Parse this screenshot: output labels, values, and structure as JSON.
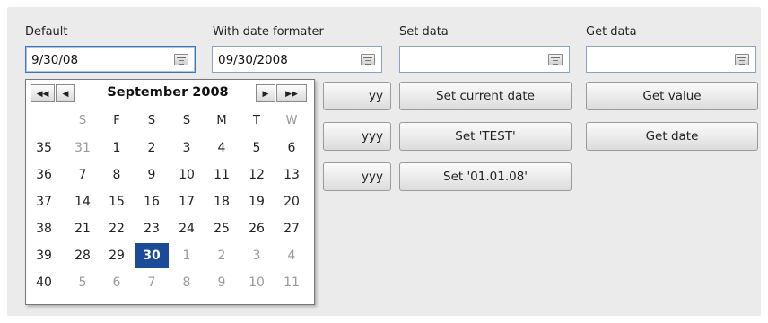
{
  "columns": [
    {
      "label": "Default",
      "value": "9/30/08"
    },
    {
      "label": "With date formater",
      "value": "09/30/2008"
    },
    {
      "label": "Set data",
      "value": ""
    },
    {
      "label": "Get data",
      "value": ""
    }
  ],
  "hidden_buttons": [
    "yy",
    "yyy",
    "yyy"
  ],
  "set_buttons": [
    "Set current date",
    "Set 'TEST'",
    "Set '01.01.08'"
  ],
  "get_buttons": [
    "Get value",
    "Get date"
  ],
  "calendar": {
    "title": "September 2008",
    "nav": {
      "prev_year": "◀◀",
      "prev_month": "◀",
      "next_month": "▶",
      "next_year": "▶▶"
    },
    "weekdays": [
      "S",
      "F",
      "S",
      "S",
      "M",
      "T",
      "W"
    ],
    "weeks": [
      {
        "num": "35",
        "days": [
          "31",
          "1",
          "2",
          "3",
          "4",
          "5",
          "6"
        ]
      },
      {
        "num": "36",
        "days": [
          "7",
          "8",
          "9",
          "10",
          "11",
          "12",
          "13"
        ]
      },
      {
        "num": "37",
        "days": [
          "14",
          "15",
          "16",
          "17",
          "18",
          "19",
          "20"
        ]
      },
      {
        "num": "38",
        "days": [
          "21",
          "22",
          "23",
          "24",
          "25",
          "26",
          "27"
        ]
      },
      {
        "num": "39",
        "days": [
          "28",
          "29",
          "30",
          "1",
          "2",
          "3",
          "4"
        ]
      },
      {
        "num": "40",
        "days": [
          "5",
          "6",
          "7",
          "8",
          "9",
          "10",
          "11"
        ]
      }
    ],
    "selected": "30",
    "accent_color": "#1a4a99"
  },
  "icons": {
    "calendar": "calendar-icon"
  }
}
